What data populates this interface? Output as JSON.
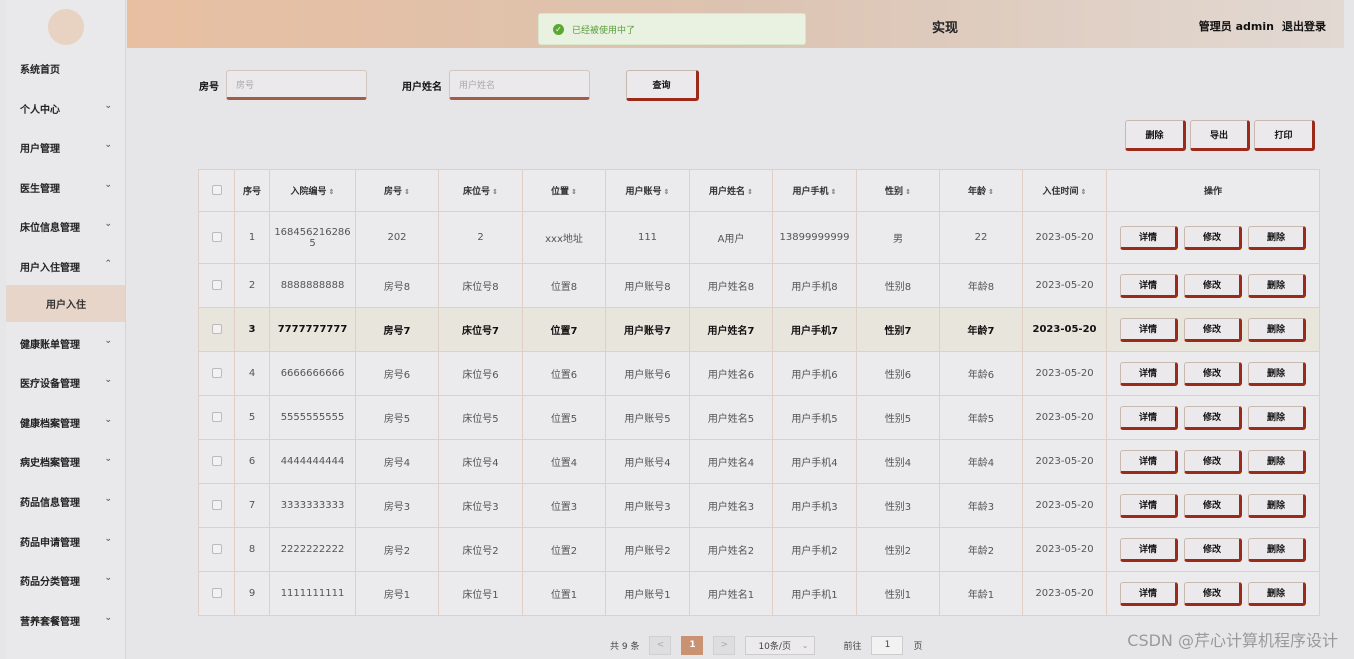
{
  "header": {
    "title_fragment": "实现",
    "admin_label": "管理员 admin",
    "logout_label": "退出登录"
  },
  "toast": {
    "message": "已经被使用中了"
  },
  "sidebar": {
    "items": [
      {
        "label": "系统首页",
        "chevron": ""
      },
      {
        "label": "个人中心",
        "chevron": "⌄"
      },
      {
        "label": "用户管理",
        "chevron": "⌄"
      },
      {
        "label": "医生管理",
        "chevron": "⌄"
      },
      {
        "label": "床位信息管理",
        "chevron": "⌄"
      },
      {
        "label": "用户入住管理",
        "chevron": "⌃"
      },
      {
        "label": "健康账单管理",
        "chevron": "⌄"
      },
      {
        "label": "医疗设备管理",
        "chevron": "⌄"
      },
      {
        "label": "健康档案管理",
        "chevron": "⌄"
      },
      {
        "label": "病史档案管理",
        "chevron": "⌄"
      },
      {
        "label": "药品信息管理",
        "chevron": "⌄"
      },
      {
        "label": "药品申请管理",
        "chevron": "⌄"
      },
      {
        "label": "药品分类管理",
        "chevron": "⌄"
      },
      {
        "label": "营养套餐管理",
        "chevron": "⌄"
      }
    ],
    "submenu_label": "用户入住"
  },
  "search": {
    "room_label": "房号",
    "room_placeholder": "房号",
    "name_label": "用户姓名",
    "name_placeholder": "用户姓名",
    "query_button": "查询"
  },
  "actions": {
    "delete": "删除",
    "export": "导出",
    "print": "打印"
  },
  "table": {
    "headers": [
      "序号",
      "入院编号",
      "房号",
      "床位号",
      "位置",
      "用户账号",
      "用户姓名",
      "用户手机",
      "性别",
      "年龄",
      "入住时间",
      "操作"
    ],
    "row_buttons": {
      "detail": "详情",
      "edit": "修改",
      "delete": "删除"
    },
    "rows": [
      [
        "1",
        "1684562162865",
        "202",
        "2",
        "xxx地址",
        "111",
        "A用户",
        "13899999999",
        "男",
        "22",
        "2023-05-20"
      ],
      [
        "2",
        "8888888888",
        "房号8",
        "床位号8",
        "位置8",
        "用户账号8",
        "用户姓名8",
        "用户手机8",
        "性别8",
        "年龄8",
        "2023-05-20"
      ],
      [
        "3",
        "7777777777",
        "房号7",
        "床位号7",
        "位置7",
        "用户账号7",
        "用户姓名7",
        "用户手机7",
        "性别7",
        "年龄7",
        "2023-05-20"
      ],
      [
        "4",
        "6666666666",
        "房号6",
        "床位号6",
        "位置6",
        "用户账号6",
        "用户姓名6",
        "用户手机6",
        "性别6",
        "年龄6",
        "2023-05-20"
      ],
      [
        "5",
        "5555555555",
        "房号5",
        "床位号5",
        "位置5",
        "用户账号5",
        "用户姓名5",
        "用户手机5",
        "性别5",
        "年龄5",
        "2023-05-20"
      ],
      [
        "6",
        "4444444444",
        "房号4",
        "床位号4",
        "位置4",
        "用户账号4",
        "用户姓名4",
        "用户手机4",
        "性别4",
        "年龄4",
        "2023-05-20"
      ],
      [
        "7",
        "3333333333",
        "房号3",
        "床位号3",
        "位置3",
        "用户账号3",
        "用户姓名3",
        "用户手机3",
        "性别3",
        "年龄3",
        "2023-05-20"
      ],
      [
        "8",
        "2222222222",
        "房号2",
        "床位号2",
        "位置2",
        "用户账号2",
        "用户姓名2",
        "用户手机2",
        "性别2",
        "年龄2",
        "2023-05-20"
      ],
      [
        "9",
        "1111111111",
        "房号1",
        "床位号1",
        "位置1",
        "用户账号1",
        "用户姓名1",
        "用户手机1",
        "性别1",
        "年龄1",
        "2023-05-20"
      ]
    ]
  },
  "pagination": {
    "total": "共 9 条",
    "prev": "<",
    "current_page": "1",
    "next": ">",
    "page_size": "10条/页",
    "goto_prefix": "前往",
    "goto_value": "1",
    "goto_suffix": "页"
  },
  "watermark": "CSDN @芹心计算机程序设计"
}
